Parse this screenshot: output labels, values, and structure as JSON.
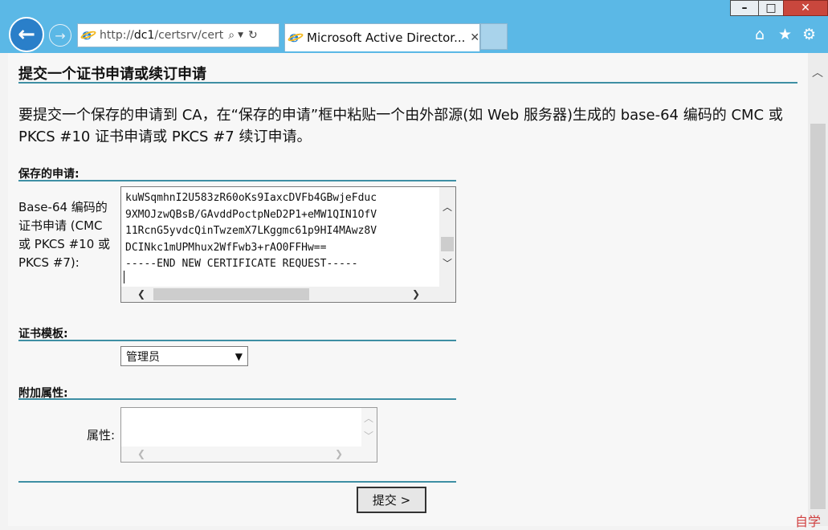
{
  "browser": {
    "url_prefix": "http://",
    "url_host": "dc1",
    "url_path": "/certsrv/cert",
    "tab_title": "Microsoft Active Director...",
    "icons": [
      "back-arrow-icon",
      "forward-arrow-icon",
      "search-icon",
      "dropdown-icon",
      "refresh-icon",
      "close-icon",
      "home-icon",
      "star-icon",
      "gear-icon"
    ]
  },
  "page": {
    "title": "提交一个证书申请或续订申请",
    "intro": "要提交一个保存的申请到 CA，在“保存的申请”框中粘贴一个由外部源(如 Web 服务器)生成的 base-64 编码的 CMC 或 PKCS #10 证书申请或 PKCS #7 续订申请。",
    "saved_request": {
      "section_label": "保存的申请:",
      "field_label": "Base-64 编码的证书申请 (CMC 或 PKCS #10 或 PKCS #7):",
      "lines": [
        "kuWSqmhnI2U583zR60oKs9IaxcDVFb4GBwjeFduc",
        "9XMOJzwQBsB/GAvddPoctpNeD2P1+eMW1QIN1OfV",
        "11RcnG5yvdcQinTwzemX7LKggmc61p9HI4MAwz8V",
        "DCINkc1mUPMhux2WfFwb3+rAO0FFHw==",
        "-----END NEW CERTIFICATE REQUEST-----"
      ]
    },
    "template": {
      "section_label": "证书模板:",
      "selected": "管理员"
    },
    "additional_attributes": {
      "section_label": "附加属性:",
      "attributes_label": "属性:",
      "value": ""
    },
    "submit_label": "提交 >"
  },
  "watermark": "自学"
}
